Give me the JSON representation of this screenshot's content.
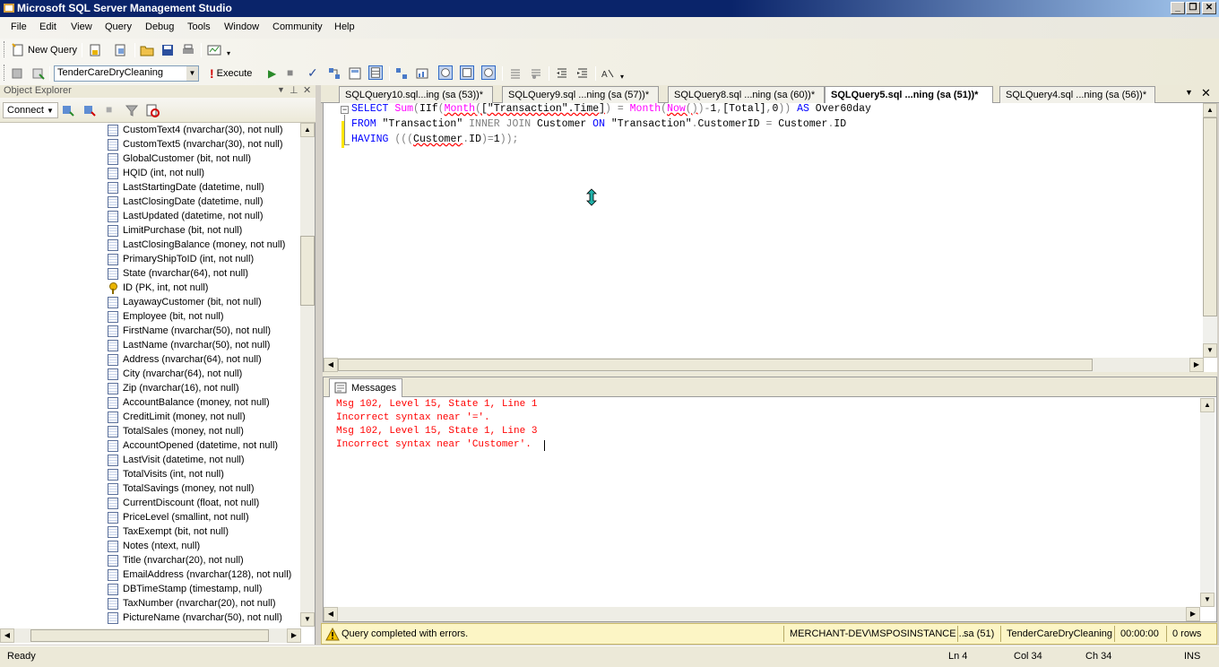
{
  "window": {
    "title": "Microsoft SQL Server Management Studio"
  },
  "menu": [
    "File",
    "Edit",
    "View",
    "Query",
    "Debug",
    "Tools",
    "Window",
    "Community",
    "Help"
  ],
  "toolbar": {
    "new_query_label": "New Query",
    "database": "TenderCareDryCleaning",
    "execute_label": "Execute"
  },
  "object_explorer": {
    "title": "Object Explorer",
    "connect_label": "Connect",
    "columns": [
      "CustomText4 (nvarchar(30), not null)",
      "CustomText5 (nvarchar(30), not null)",
      "GlobalCustomer (bit, not null)",
      "HQID (int, not null)",
      "LastStartingDate (datetime, null)",
      "LastClosingDate (datetime, null)",
      "LastUpdated (datetime, not null)",
      "LimitPurchase (bit, not null)",
      "LastClosingBalance (money, not null)",
      "PrimaryShipToID (int, not null)",
      "State (nvarchar(64), not null)",
      "ID (PK, int, not null)",
      "LayawayCustomer (bit, not null)",
      "Employee (bit, not null)",
      "FirstName (nvarchar(50), not null)",
      "LastName (nvarchar(50), not null)",
      "Address (nvarchar(64), not null)",
      "City (nvarchar(64), not null)",
      "Zip (nvarchar(16), not null)",
      "AccountBalance (money, not null)",
      "CreditLimit (money, not null)",
      "TotalSales (money, not null)",
      "AccountOpened (datetime, not null)",
      "LastVisit (datetime, not null)",
      "TotalVisits (int, not null)",
      "TotalSavings (money, not null)",
      "CurrentDiscount (float, not null)",
      "PriceLevel (smallint, not null)",
      "TaxExempt (bit, not null)",
      "Notes (ntext, null)",
      "Title (nvarchar(20), not null)",
      "EmailAddress (nvarchar(128), not null)",
      "DBTimeStamp (timestamp, null)",
      "TaxNumber (nvarchar(20), not null)",
      "PictureName (nvarchar(50), not null)"
    ],
    "key_index": 11
  },
  "tabs": [
    "SQLQuery10.sql...ing (sa (53))*",
    "SQLQuery9.sql ...ning (sa (57))*",
    "SQLQuery8.sql ...ning (sa (60))*",
    "SQLQuery5.sql ...ning (sa (51))*",
    "SQLQuery4.sql ...ning (sa (56))*"
  ],
  "editor": {
    "line1": "SELECT Sum(IIf(Month([\"Transaction\".Time]) = Month(Now())-1,[Total],0)) AS Over60day",
    "line2": "FROM \"Transaction\" INNER JOIN Customer ON \"Transaction\".CustomerID = Customer.ID",
    "line3": "HAVING (((Customer.ID)=1));"
  },
  "results": {
    "tab_label": "Messages",
    "messages": [
      "Msg 102, Level 15, State 1, Line 1",
      "Incorrect syntax near '='.",
      "Msg 102, Level 15, State 1, Line 3",
      "Incorrect syntax near 'Customer'."
    ]
  },
  "query_status": {
    "message": "Query completed with errors.",
    "server": "MERCHANT-DEV\\MSPOSINSTANCE ...",
    "user": "sa (51)",
    "database": "TenderCareDryCleaning",
    "elapsed": "00:00:00",
    "rows": "0 rows"
  },
  "statusbar": {
    "state": "Ready",
    "ln": "Ln 4",
    "col": "Col 34",
    "ch": "Ch 34",
    "mode": "INS"
  },
  "colors": {
    "keyword": "#0000ff",
    "function": "#ff00ff",
    "string": "#ff0000",
    "error": "#ff0000",
    "status_bg": "#fcf5c5"
  }
}
